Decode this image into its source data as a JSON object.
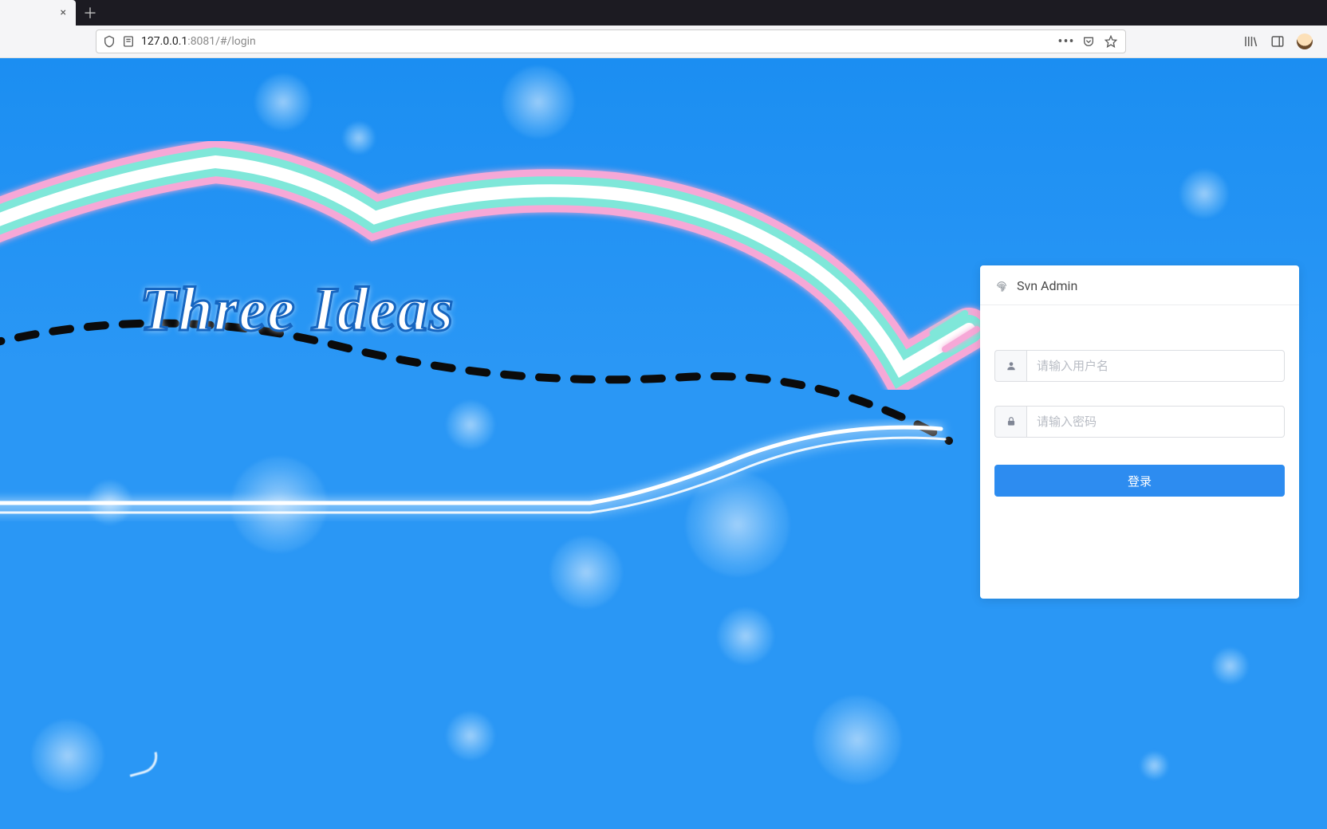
{
  "browser": {
    "url_host": "127.0.0.1",
    "url_port_path": ":8081/#/login"
  },
  "page": {
    "hero_title": "Three Ideas"
  },
  "login": {
    "title": "Svn Admin",
    "username_placeholder": "请输入用户名",
    "password_placeholder": "请输入密码",
    "submit_label": "登录"
  },
  "colors": {
    "primary": "#2d8cf0",
    "page_bg": "#2a97f5"
  }
}
